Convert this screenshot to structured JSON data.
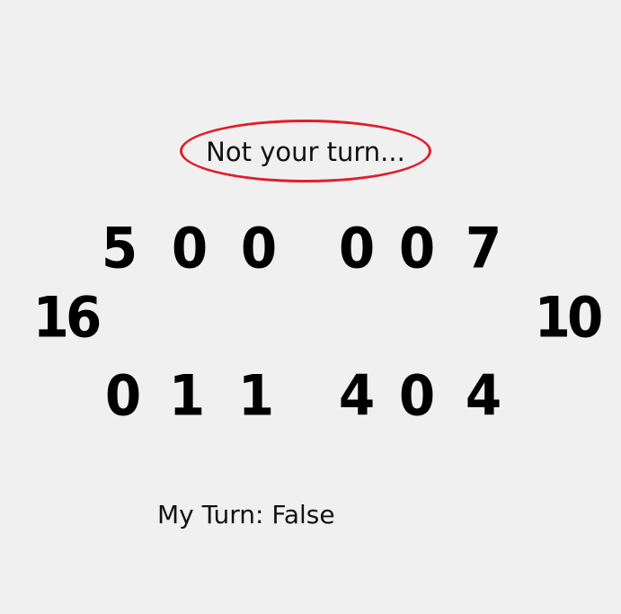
{
  "status": {
    "message": "Not your turn...",
    "highlight_color": "#e01e2a"
  },
  "board": {
    "top_row": [
      "5",
      "0",
      "0",
      "0",
      "0",
      "7"
    ],
    "bottom_row": [
      "0",
      "1",
      "1",
      "4",
      "0",
      "4"
    ],
    "left_store": "16",
    "right_store": "10"
  },
  "footer": {
    "turn_text": "My Turn: False"
  }
}
